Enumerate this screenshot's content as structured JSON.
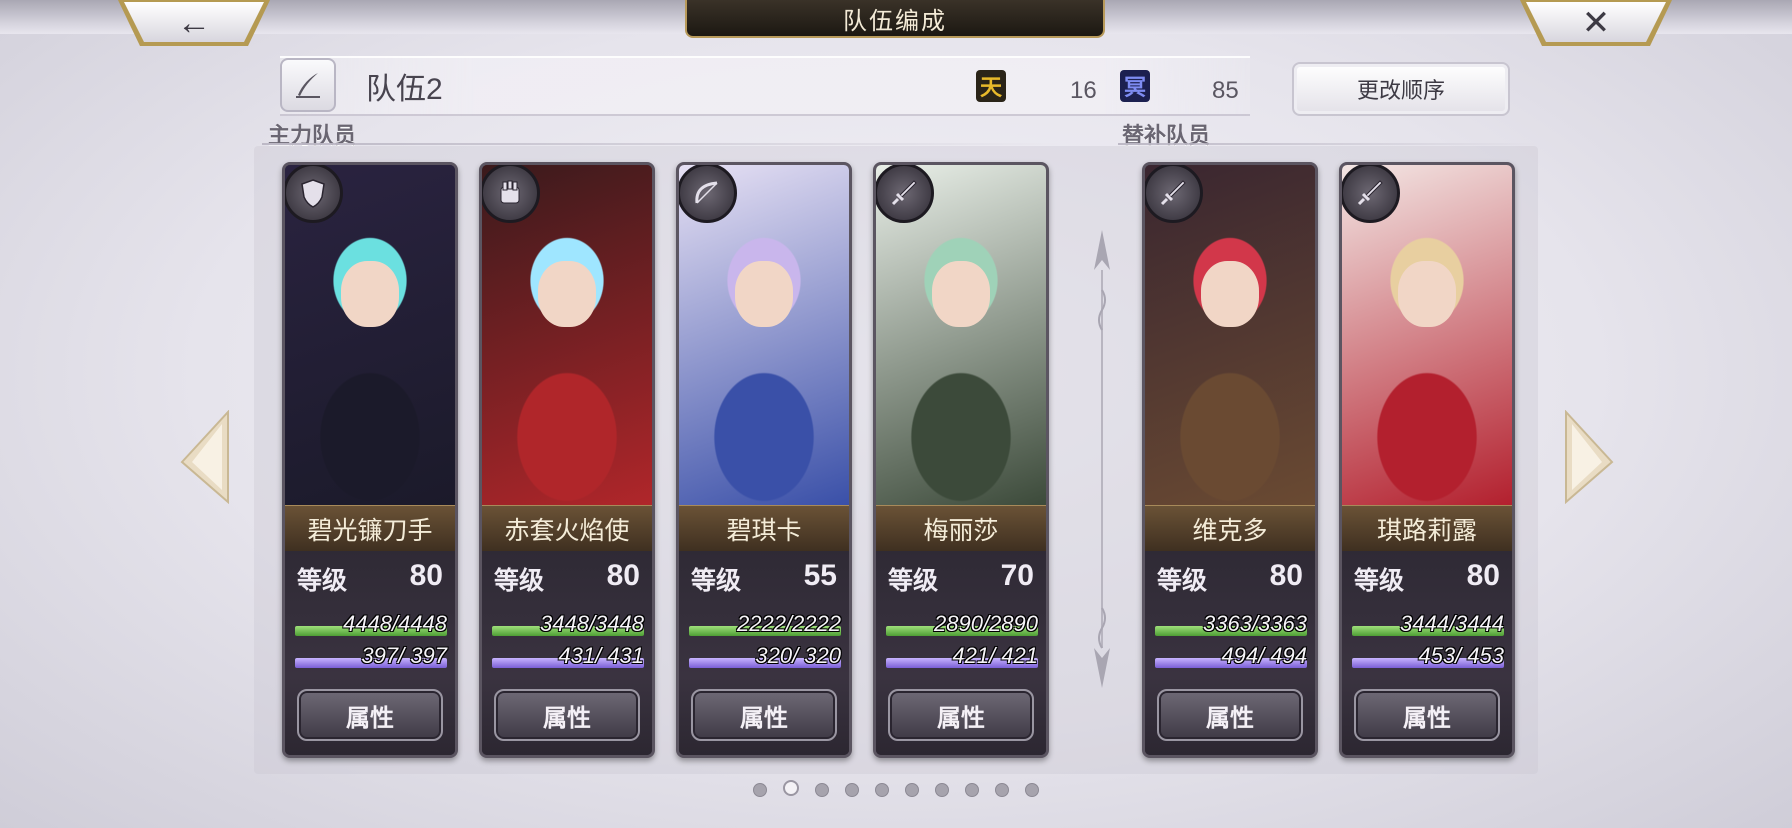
{
  "header": {
    "title": "队伍编成",
    "back_icon": "←",
    "close_icon": "✕"
  },
  "team": {
    "name": "队伍2",
    "heaven_icon": "天",
    "heaven_value": "16",
    "underworld_icon": "冥",
    "underworld_value": "85",
    "reorder_label": "更改顺序"
  },
  "sections": {
    "main_label": "主力队员",
    "sub_label": "替补队员"
  },
  "stat_labels": {
    "level": "等级",
    "attribute_button": "属性"
  },
  "members": [
    {
      "name": "碧光镰刀手",
      "level": "80",
      "hp": "4448/4448",
      "mp": "397/ 397",
      "hp_ratio": 1,
      "mp_ratio": 1,
      "type": "shield-icon",
      "theme": [
        "#2a2340",
        "#6be0e0",
        "#1b1a2a"
      ]
    },
    {
      "name": "赤套火焰使",
      "level": "80",
      "hp": "3448/3448",
      "mp": "431/ 431",
      "hp_ratio": 1,
      "mp_ratio": 1,
      "type": "gauntlet-icon",
      "theme": [
        "#3a1a1c",
        "#9fe6ff",
        "#b0262a"
      ]
    },
    {
      "name": "碧琪卡",
      "level": "55",
      "hp": "2222/2222",
      "mp": "320/ 320",
      "hp_ratio": 1,
      "mp_ratio": 1,
      "type": "bow-icon",
      "theme": [
        "#e7e1f4",
        "#c9b6ec",
        "#3a50a8"
      ]
    },
    {
      "name": "梅丽莎",
      "level": "70",
      "hp": "2890/2890",
      "mp": "421/ 421",
      "hp_ratio": 1,
      "mp_ratio": 1,
      "type": "sword-icon",
      "theme": [
        "#e9efe8",
        "#9fd2b8",
        "#3c4a3a"
      ]
    },
    {
      "name": "维克多",
      "level": "80",
      "hp": "3363/3363",
      "mp": "494/ 494",
      "hp_ratio": 1,
      "mp_ratio": 1,
      "type": "sword-icon",
      "theme": [
        "#3a2630",
        "#d2374a",
        "#6a4a32"
      ]
    },
    {
      "name": "琪路莉露",
      "level": "80",
      "hp": "3444/3444",
      "mp": "453/ 453",
      "hp_ratio": 1,
      "mp_ratio": 1,
      "type": "sword-icon",
      "theme": [
        "#f3e6e4",
        "#e8cfa0",
        "#b3202e"
      ]
    }
  ],
  "pager": {
    "count": 10,
    "active_index": 1
  },
  "colors": {
    "heaven": "#e7b92a",
    "underworld": "#2f3a8a",
    "hp": "#6fc04c",
    "mp": "#9d86ea"
  }
}
